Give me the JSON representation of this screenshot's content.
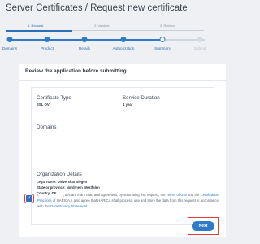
{
  "header": {
    "title": "Server Certificates / Request new certificate"
  },
  "steps": [
    {
      "label": "1. Request",
      "state": "active"
    },
    {
      "label": "2. Validate",
      "state": "pending"
    },
    {
      "label": "3. Retrieve",
      "state": "pending"
    }
  ],
  "progress": {
    "items": [
      {
        "label": "Domains",
        "state": "done"
      },
      {
        "label": "Product",
        "state": "done"
      },
      {
        "label": "Details",
        "state": "done"
      },
      {
        "label": "Authorization",
        "state": "done"
      },
      {
        "label": "Summary",
        "state": "current"
      },
      {
        "label": "Submit",
        "state": "pending"
      }
    ]
  },
  "review": {
    "title": "Review the application before submitting",
    "certificate_type_label": "Certificate Type",
    "certificate_type_value": "SSL OV",
    "service_duration_label": "Service Duration",
    "service_duration_value": "1 year",
    "domains_label": "Domains",
    "org_label": "Organization Details",
    "legal_name_label": "Legal name:",
    "legal_name_value": "Universität Siegen",
    "state_label": "State or province:",
    "state_value": "Nordrhein Westfalen",
    "country_label": "Country:",
    "country_value": "DE"
  },
  "agreement": {
    "checked": true,
    "text_1": "I, ",
    "text_2": ", declare that I read and agree with, by submitting this request, the ",
    "terms_link": "Terms of Use",
    "text_3": " and the ",
    "cps_link": "Certification Practices",
    "text_4": " of HARICA. I also agree that HARICA shall process, use and store the data from this request in accordance with the ",
    "privacy_link": "Data Privacy Statement",
    "text_5": "."
  },
  "actions": {
    "next_label": "Next"
  },
  "colors": {
    "accent": "#2f7bc7",
    "highlight": "#e53a3a"
  }
}
